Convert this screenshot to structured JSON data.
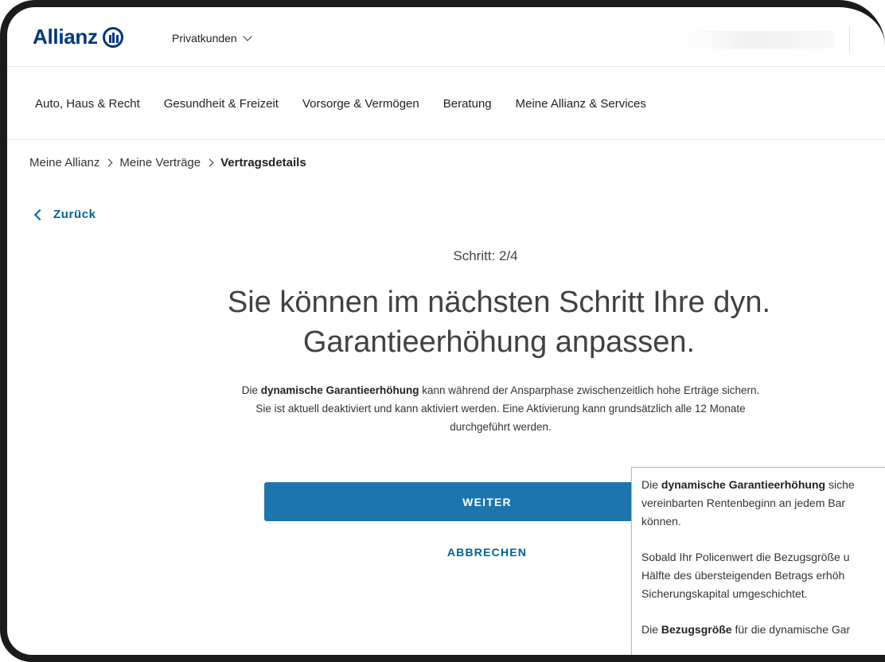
{
  "header": {
    "brand": "Allianz",
    "segment": "Privatkunden"
  },
  "nav": {
    "items": [
      "Auto, Haus & Recht",
      "Gesundheit & Freizeit",
      "Vorsorge & Vermögen",
      "Beratung",
      "Meine Allianz & Services"
    ]
  },
  "breadcrumb": {
    "items": [
      "Meine Allianz",
      "Meine Verträge"
    ],
    "current": "Vertragsdetails"
  },
  "back_label": "Zurück",
  "step_label": "Schritt: 2/4",
  "headline_line1": "Sie können im nächsten Schritt Ihre dyn.",
  "headline_line2": "Garantieerhöhung anpassen.",
  "description": {
    "pre": "Die ",
    "bold": "dynamische Garantieerhöhung",
    "line1_rest": " kann während der Ansparphase zwischenzeitlich hohe Erträge sichern.",
    "line2": "Sie ist aktuell deaktiviert und kann aktiviert werden. Eine Aktivierung kann grundsätzlich alle 12 Monate",
    "line3": "durchgeführt werden."
  },
  "buttons": {
    "continue": "WEITER",
    "cancel": "ABBRECHEN"
  },
  "tooltip": {
    "p1_pre": "Die ",
    "p1_bold": "dynamische Garantieerhöhung",
    "p1_rest": " siche",
    "p1_line2": "vereinbarten Rentenbeginn an jedem Bar",
    "p1_line3": "können.",
    "p2_line1": "Sobald Ihr Policenwert die Bezugsgröße u",
    "p2_line2": "Hälfte des übersteigenden Betrags erhöh",
    "p2_line3": "Sicherungskapital umgeschichtet.",
    "p3_pre": "Die ",
    "p3_bold": "Bezugsgröße",
    "p3_rest": " für die dynamische Gar"
  },
  "colors": {
    "brand_blue": "#003781",
    "link_blue": "#006192",
    "button_blue": "#1d75ad"
  }
}
